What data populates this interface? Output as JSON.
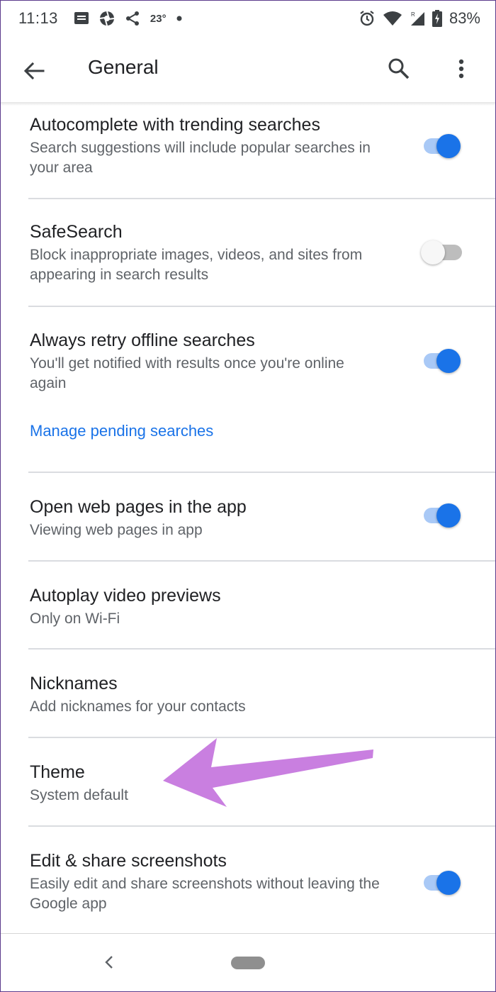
{
  "status_bar": {
    "time": "11:13",
    "temperature": "23°",
    "battery": "83%",
    "icons": [
      "message-icon",
      "camera-aperture-icon",
      "share-icon",
      "dot-icon",
      "alarm-icon",
      "wifi-icon",
      "signal-icon",
      "battery-charging-icon"
    ]
  },
  "app_bar": {
    "title": "General",
    "icons": [
      "back-arrow-icon",
      "search-icon",
      "more-vert-icon"
    ]
  },
  "settings": [
    {
      "title": "Autocomplete with trending searches",
      "subtitle": "Search suggestions will include popular searches in your area",
      "toggle": true
    },
    {
      "title": "SafeSearch",
      "subtitle": "Block inappropriate images, videos, and sites from appearing in search results",
      "toggle": false
    },
    {
      "title": "Always retry offline searches",
      "subtitle": "You'll get notified with results once you're online again",
      "toggle": true,
      "link": "Manage pending searches"
    },
    {
      "title": "Open web pages in the app",
      "subtitle": "Viewing web pages in app",
      "toggle": true
    },
    {
      "title": "Autoplay video previews",
      "subtitle": "Only on Wi-Fi"
    },
    {
      "title": "Nicknames",
      "subtitle": "Add nicknames for your contacts"
    },
    {
      "title": "Theme",
      "subtitle": "System default"
    },
    {
      "title": "Edit & share screenshots",
      "subtitle": "Easily edit and share screenshots without leaving the Google app",
      "toggle": true
    }
  ],
  "annotation": {
    "color": "#c97fe0",
    "points_to": "Theme"
  },
  "colors": {
    "accent": "#1a73e8",
    "toggle_track_on": "#a9c9f6",
    "text_primary": "#202124",
    "text_secondary": "#5f6368",
    "divider": "#dadce0"
  }
}
